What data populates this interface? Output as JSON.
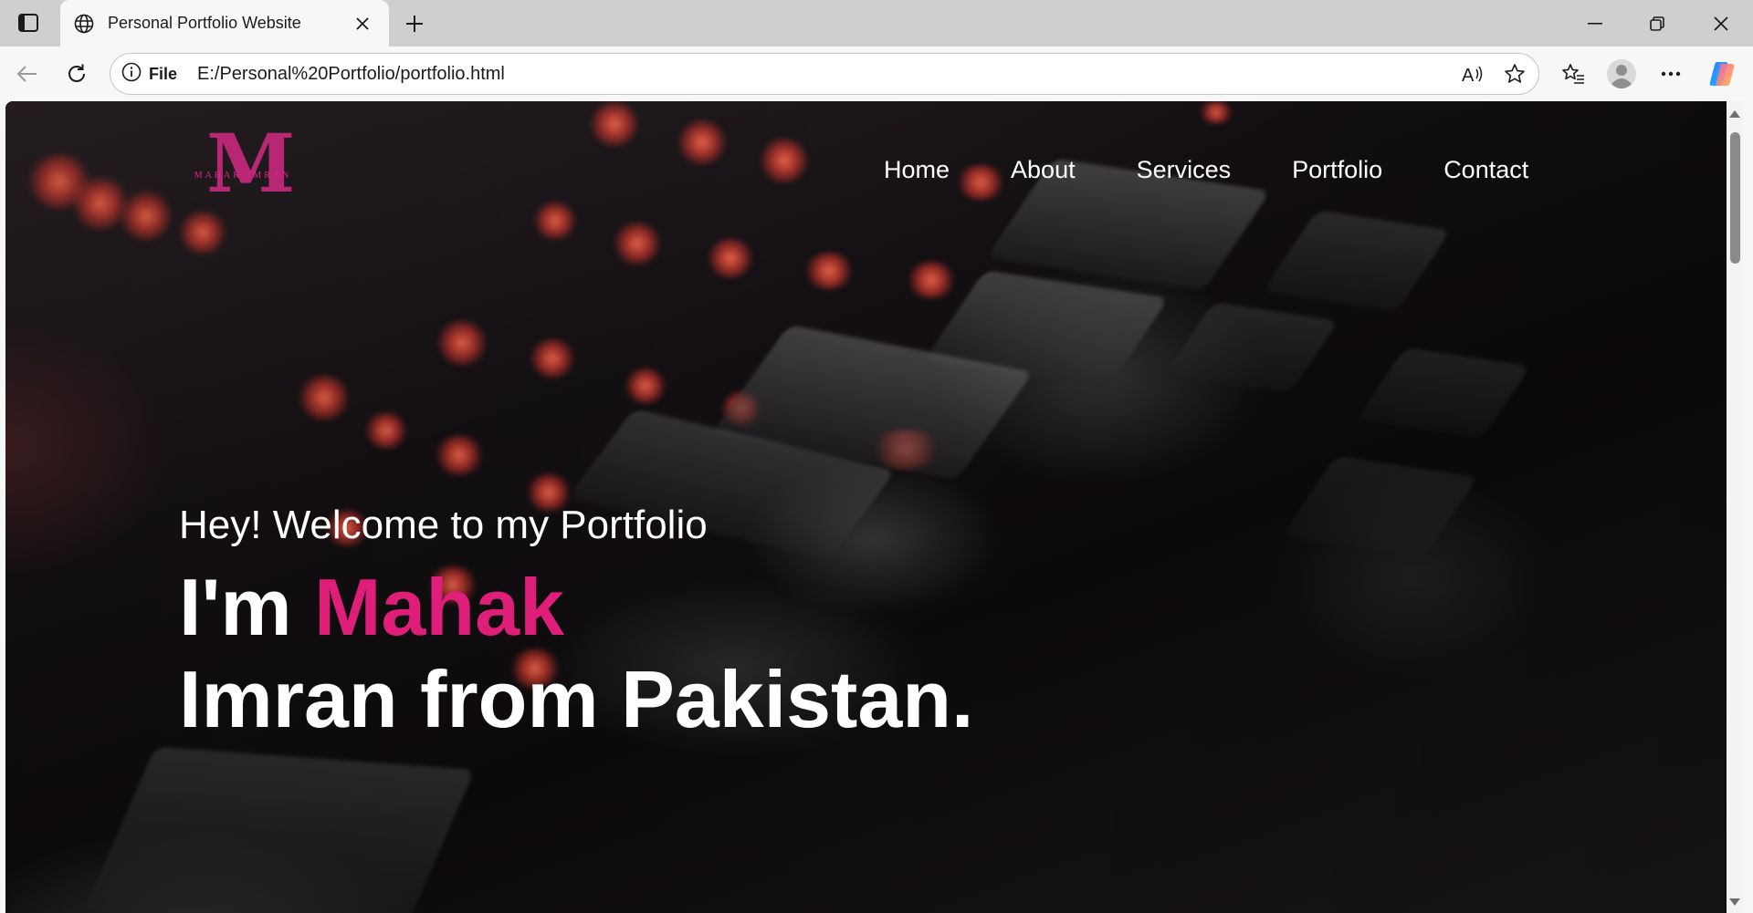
{
  "browser": {
    "tab_title": "Personal Portfolio Website",
    "site_info_label": "File",
    "url": "E:/Personal%20Portfolio/portfolio.html",
    "icons": {
      "tab_actions": "tab-actions-icon",
      "favicon": "globe-icon",
      "tab_close": "close-icon",
      "new_tab": "plus-icon",
      "minimize": "minimize-icon",
      "restore": "restore-icon",
      "close_window": "close-icon",
      "back": "back-arrow-icon",
      "refresh": "refresh-icon",
      "info": "info-icon",
      "read_aloud": "read-aloud-icon",
      "favorite": "star-icon",
      "favorites": "favorites-icon",
      "profile": "profile-icon",
      "more": "more-icon",
      "copilot": "copilot-icon"
    }
  },
  "site": {
    "logo": {
      "monogram": "M",
      "name": "MAHAK IMRAN"
    },
    "nav": [
      "Home",
      "About",
      "Services",
      "Portfolio",
      "Contact"
    ],
    "hero": {
      "greeting": "Hey! Welcome to my Portfolio",
      "prefix": "I'm ",
      "name": "Mahak",
      "line2": "Imran from Pakistan."
    },
    "colors": {
      "accent": "#de1e79",
      "logo": "#d32a84"
    }
  }
}
